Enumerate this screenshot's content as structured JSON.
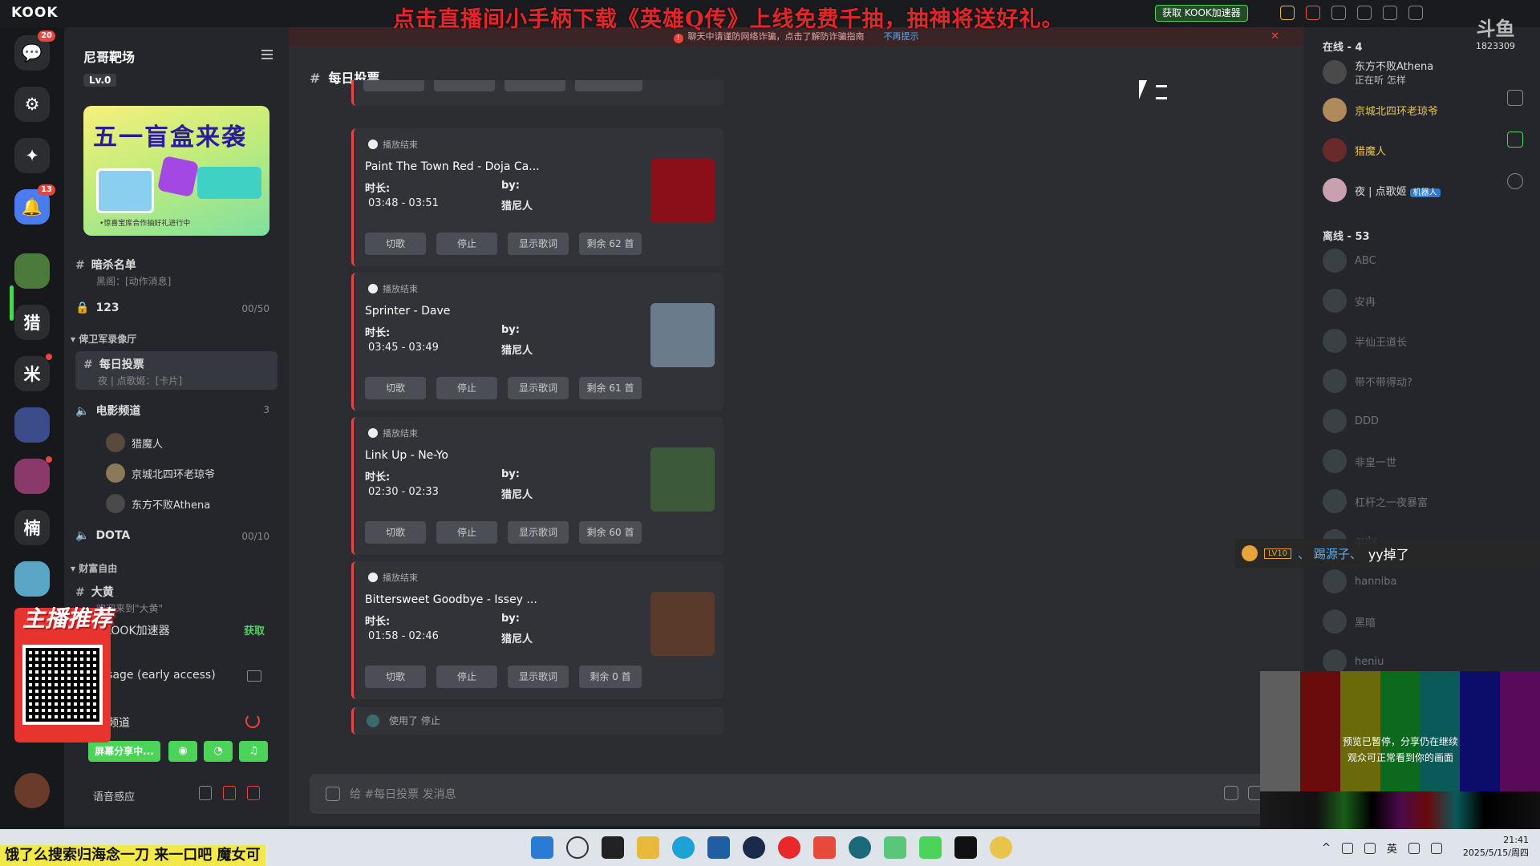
{
  "stream": {
    "app_brand": "KOOK",
    "promo_text": "点击直播间小手柄下载《英雄Q传》上线免费千抽，抽神将送好礼。",
    "accelerator_button": "获取 KOOK加速器",
    "streamer_badge": "斗鱼",
    "room_id": "1823309",
    "recommend_title": "主播推荐",
    "sub_caption": "饿了么搜索归海念一刀 来一口吧 魔女可"
  },
  "server_rail": {
    "items": [
      {
        "icon": "chat-bubble-icon",
        "badge": "20"
      },
      {
        "icon": "compass-icon"
      },
      {
        "icon": "sparkle-icon"
      },
      {
        "icon": "bell-icon",
        "badge": "13"
      },
      {
        "label": "猎"
      },
      {
        "label": "米"
      },
      {
        "label": "楠"
      }
    ]
  },
  "sidebar": {
    "guild_name": "尼哥靶场",
    "level": "Lv.0",
    "banner": {
      "title": "五一盲盒来袭",
      "caption": "•惊喜宝库合作抽好礼进行中"
    },
    "channels": [
      {
        "name": "暗杀名单",
        "sub": "黑阁：[动作消息]"
      },
      {
        "name": "123",
        "count": "00/50"
      }
    ],
    "category1": "俾卫军录像厅",
    "selected_channel": {
      "name": "每日投票",
      "sub": "夜 | 点歌姬：[卡片]"
    },
    "voice_channel": {
      "name": "电影频道",
      "count": "3"
    },
    "voice_users": [
      "猎魔人",
      "京城北四环老琼爷",
      "东方不败Athena"
    ],
    "dota": {
      "name": "DOTA",
      "count": "00/10"
    },
    "category2": "财富自由",
    "big_yellow": {
      "name": "大黄",
      "sub": "欢迎来到\"大黄\""
    },
    "accelerator": {
      "label": "KOOK加速器",
      "get": "获取"
    },
    "visage": "Visage (early access)",
    "connected_channel": "影频道",
    "share_button": "屏幕分享中...",
    "voice_sense": "语音感应"
  },
  "main": {
    "warning": "聊天中请谨防网络诈骗，点击了解防诈骗指南",
    "warning_dismiss": "不再提示",
    "channel_title": "每日投票",
    "status_label": "播放结束",
    "duration_label": "时长:",
    "by_label": "by:",
    "buttons": {
      "skip": "切歌",
      "stop": "停止",
      "lyrics": "显示歌词"
    },
    "cards": [
      {
        "song": "Paint The Town Red - Doja Ca...",
        "time": "03:48 - 03:51",
        "by": "猎尼人",
        "remaining": "剩余 62 首",
        "cover": "#8a0f18"
      },
      {
        "song": "Sprinter - Dave",
        "time": "03:45 - 03:49",
        "by": "猎尼人",
        "remaining": "剩余 61 首",
        "cover": "#6a7c8c"
      },
      {
        "song": "Link Up - Ne-Yo",
        "time": "02:30 - 02:33",
        "by": "猎尼人",
        "remaining": "剩余 60 首",
        "cover": "#3c5a3a"
      },
      {
        "song": "Bittersweet Goodbye - Issey ...",
        "time": "01:58 - 02:46",
        "by": "猎尼人",
        "remaining": "剩余 0 首",
        "cover": "#5a3a2a"
      }
    ],
    "system_message": "使用了 停止",
    "composer_placeholder": "给 #每日投票 发消息"
  },
  "members": {
    "online_header": "在线 - 4",
    "online": [
      {
        "name": "东方不败Athena",
        "sub": "正在听 怎样",
        "style": ""
      },
      {
        "name": "京城北四环老琼爷",
        "style": "gold"
      },
      {
        "name": "猎魔人",
        "style": "gold"
      },
      {
        "name": "夜 | 点歌姬",
        "bot": "机器人",
        "style": ""
      }
    ],
    "offline_header": "离线 - 53",
    "offline": [
      "ABC",
      "安冉",
      "半仙王道长",
      "带不带得动?",
      "DDD",
      "非皇一世",
      "杠杆之一夜暴富",
      "quix",
      "hanniba",
      "黑暗",
      "heniu"
    ]
  },
  "danmaku": {
    "level": "LV10",
    "user": "、 踢源子、",
    "text": "yy掉了"
  },
  "preview": {
    "line1": "预览已暂停，分享仍在继续",
    "line2": "观众可正常看到你的画面"
  },
  "taskbar": {
    "ime": "英",
    "time": "21:41",
    "date": "2025/5/15/周四"
  }
}
